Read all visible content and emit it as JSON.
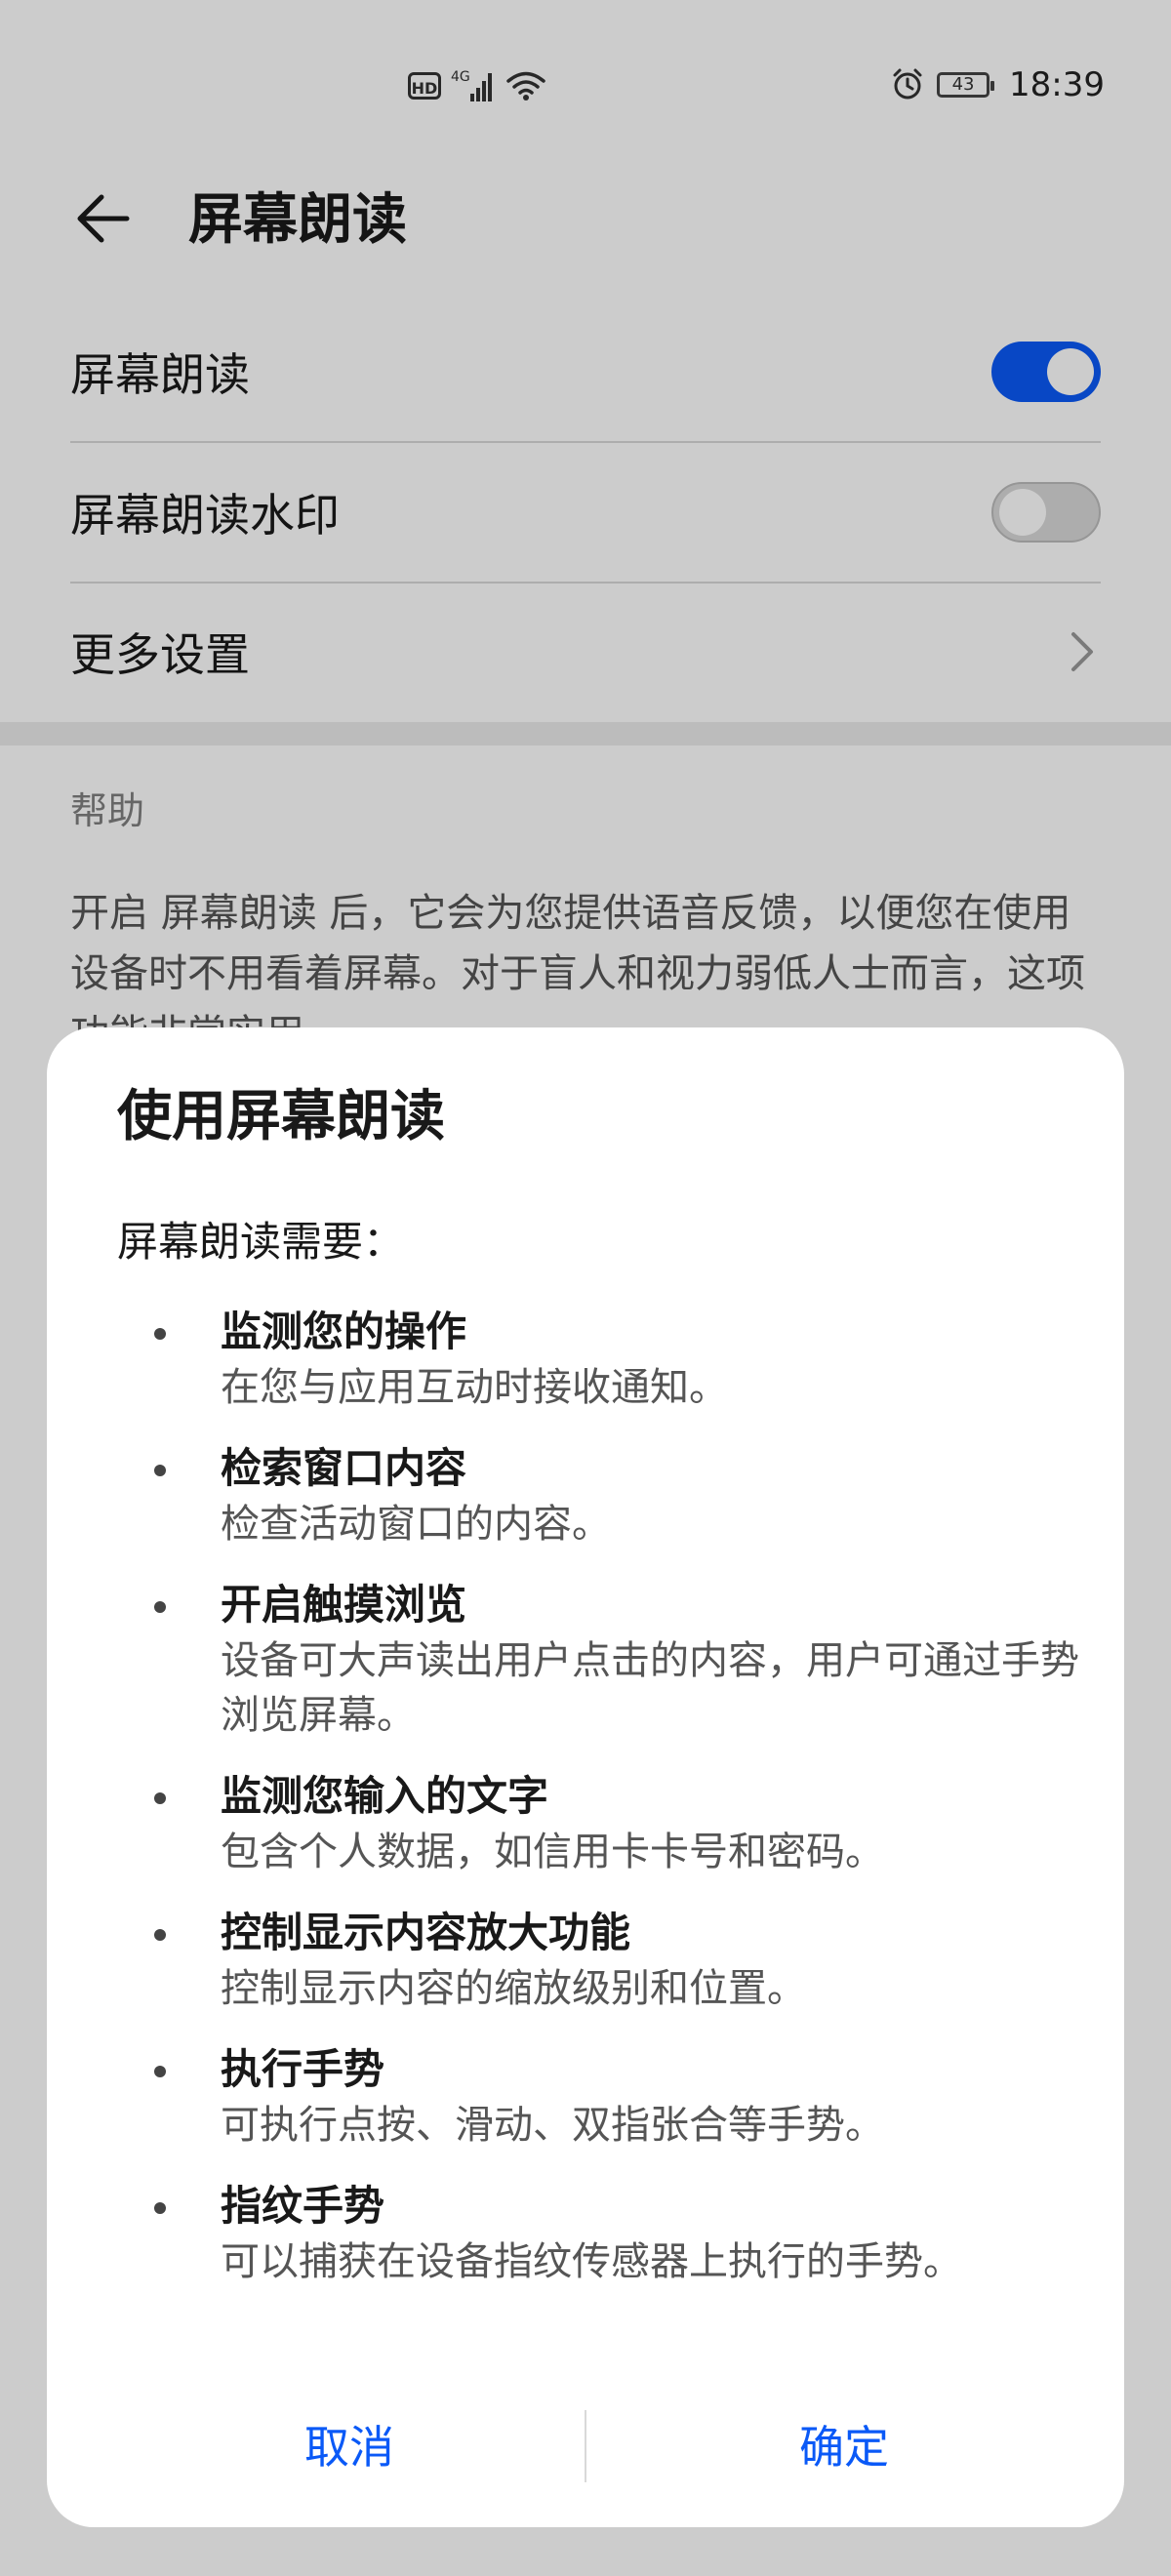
{
  "status_bar": {
    "hd": "HD",
    "network": "4G",
    "battery": "43",
    "time": "18:39"
  },
  "header": {
    "title": "屏幕朗读"
  },
  "settings": {
    "items": [
      {
        "label": "屏幕朗读",
        "state": "on"
      },
      {
        "label": "屏幕朗读水印",
        "state": "off"
      },
      {
        "label": "更多设置"
      }
    ]
  },
  "help": {
    "title": "帮助",
    "text": "开启 屏幕朗读 后，它会为您提供语音反馈，以便您在使用设备时不用看着屏幕。对于盲人和视力弱低人士而言，这项功能非常实用。"
  },
  "dialog": {
    "title": "使用屏幕朗读",
    "subtitle": "屏幕朗读需要：",
    "permissions": [
      {
        "title": "监测您的操作",
        "desc": "在您与应用互动时接收通知。"
      },
      {
        "title": "检索窗口内容",
        "desc": "检查活动窗口的内容。"
      },
      {
        "title": "开启触摸浏览",
        "desc": "设备可大声读出用户点击的内容，用户可通过手势浏览屏幕。"
      },
      {
        "title": "监测您输入的文字",
        "desc": "包含个人数据，如信用卡卡号和密码。"
      },
      {
        "title": "控制显示内容放大功能",
        "desc": "控制显示内容的缩放级别和位置。"
      },
      {
        "title": "执行手势",
        "desc": "可执行点按、滑动、双指张合等手势。"
      },
      {
        "title": "指纹手势",
        "desc": "可以捕获在设备指纹传感器上执行的手势。"
      }
    ],
    "cancel_label": "取消",
    "ok_label": "确定"
  },
  "colors": {
    "accent": "#0a59f7",
    "scrim": "rgba(0,0,0,0.2)"
  }
}
